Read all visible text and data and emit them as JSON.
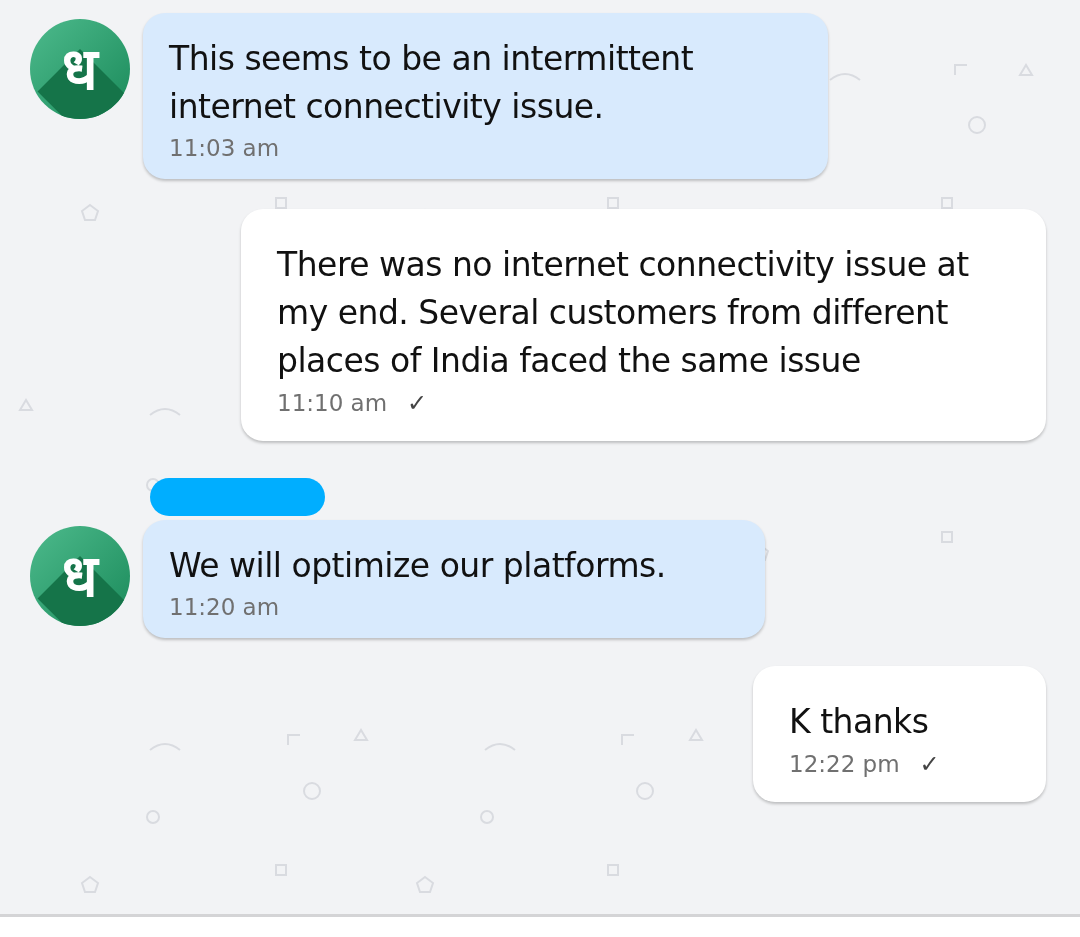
{
  "messages": [
    {
      "kind": "incoming",
      "avatar": "ध",
      "text": "This seems to be an intermittent internet connectivity issue.",
      "time": "11:03 am"
    },
    {
      "kind": "outgoing",
      "text": "There was no internet connectivity issue at my end. Several customers from different places of India faced the same issue",
      "time": "11:10 am",
      "tick": "✓"
    },
    {
      "kind": "incoming",
      "redacted_sender": true,
      "avatar": "ध",
      "text": "We will optimize our platforms.",
      "time": "11:20 am"
    },
    {
      "kind": "outgoing",
      "text": "K thanks",
      "time": "12:22 pm",
      "tick": "✓"
    }
  ]
}
